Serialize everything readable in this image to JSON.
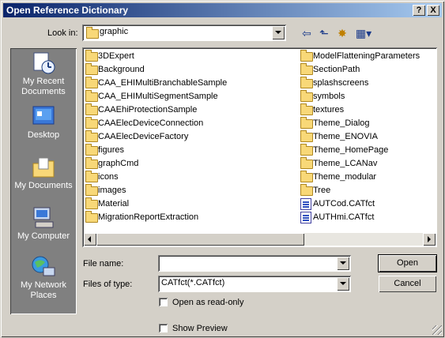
{
  "window": {
    "title": "Open Reference Dictionary",
    "help_glyph": "?",
    "close_glyph": "X"
  },
  "lookin": {
    "label": "Look in:",
    "value": "graphic"
  },
  "toolbar": {
    "back_glyph": "⇦",
    "up_glyph": "⬑",
    "newfolder_glyph": "✸",
    "views_glyph": "▦▾"
  },
  "places": [
    {
      "label": "My Recent Documents",
      "icon": "recent-documents-icon"
    },
    {
      "label": "Desktop",
      "icon": "desktop-icon"
    },
    {
      "label": "My Documents",
      "icon": "my-documents-icon"
    },
    {
      "label": "My Computer",
      "icon": "my-computer-icon"
    },
    {
      "label": "My Network Places",
      "icon": "network-places-icon"
    }
  ],
  "files_col1": [
    {
      "name": "3DExpert",
      "type": "folder"
    },
    {
      "name": "Background",
      "type": "folder"
    },
    {
      "name": "CAA_EHIMultiBranchableSample",
      "type": "folder"
    },
    {
      "name": "CAA_EHIMultiSegmentSample",
      "type": "folder"
    },
    {
      "name": "CAAEhiProtectionSample",
      "type": "folder"
    },
    {
      "name": "CAAElecDeviceConnection",
      "type": "folder"
    },
    {
      "name": "CAAElecDeviceFactory",
      "type": "folder"
    },
    {
      "name": "figures",
      "type": "folder"
    },
    {
      "name": "graphCmd",
      "type": "folder"
    },
    {
      "name": "icons",
      "type": "folder"
    },
    {
      "name": "images",
      "type": "folder"
    },
    {
      "name": "Material",
      "type": "folder"
    },
    {
      "name": "MigrationReportExtraction",
      "type": "folder"
    }
  ],
  "files_col2": [
    {
      "name": "ModelFlatteningParameters",
      "type": "folder"
    },
    {
      "name": "SectionPath",
      "type": "folder"
    },
    {
      "name": "splashscreens",
      "type": "folder"
    },
    {
      "name": "symbols",
      "type": "folder"
    },
    {
      "name": "textures",
      "type": "folder"
    },
    {
      "name": "Theme_Dialog",
      "type": "folder"
    },
    {
      "name": "Theme_ENOVIA",
      "type": "folder"
    },
    {
      "name": "Theme_HomePage",
      "type": "folder"
    },
    {
      "name": "Theme_LCANav",
      "type": "folder"
    },
    {
      "name": "Theme_modular",
      "type": "folder"
    },
    {
      "name": "Tree",
      "type": "folder"
    },
    {
      "name": "AUTCod.CATfct",
      "type": "file"
    },
    {
      "name": "AUTHmi.CATfct",
      "type": "file"
    }
  ],
  "form": {
    "filename_label": "File name:",
    "filename_value": "",
    "filetype_label": "Files of type:",
    "filetype_value": "CATfct(*.CATfct)",
    "readonly_label": "Open as read-only",
    "preview_label": "Show Preview"
  },
  "buttons": {
    "open": "Open",
    "cancel": "Cancel"
  },
  "colors": {
    "title_start": "#0a246a",
    "title_end": "#a6caf0",
    "face": "#d4d0c8",
    "places_bg": "#808080"
  }
}
